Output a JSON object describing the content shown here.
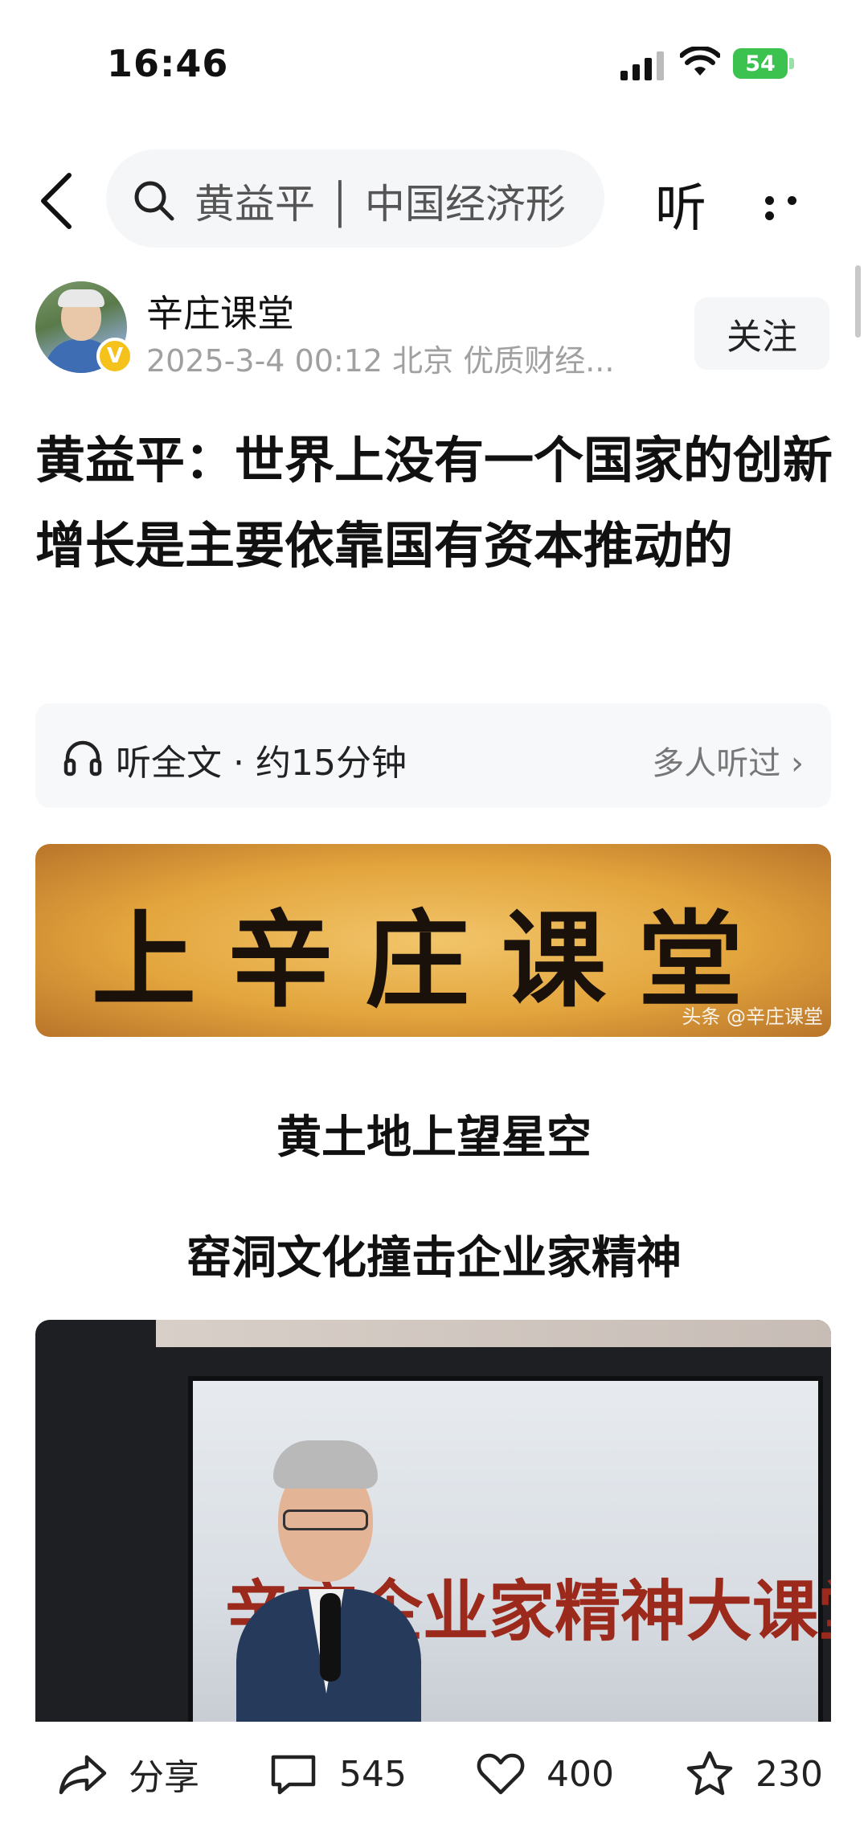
{
  "status_bar": {
    "time": "16:46",
    "battery": "54"
  },
  "nav": {
    "search_text": "黄益平 │ 中国经济形",
    "listen_label": "听"
  },
  "author": {
    "name": "辛庄课堂",
    "verified_mark": "V",
    "meta": "2025-3-4 00:12 北京  优质财经...",
    "follow_label": "关注"
  },
  "article": {
    "title": "黄益平：世界上没有一个国家的创新增长是主要依靠国有资本推动的"
  },
  "listen_panel": {
    "full_text": "听全文 · 约15分钟",
    "others": "多人听过 ›"
  },
  "banner": {
    "text": "上辛庄课堂",
    "watermark": "头条 @辛庄课堂"
  },
  "subheadings": {
    "first": "黄土地上望星空",
    "second": "窑洞文化撞击企业家精神"
  },
  "photo": {
    "screen_text": "辛庄企业家精神大课堂"
  },
  "actions": {
    "share_label": "分享",
    "comments_count": "545",
    "likes_count": "400",
    "favorites_count": "230"
  },
  "colors": {
    "battery": "#3cc24f",
    "verified": "#f4c21b",
    "banner_gold": "#e3a53d"
  }
}
